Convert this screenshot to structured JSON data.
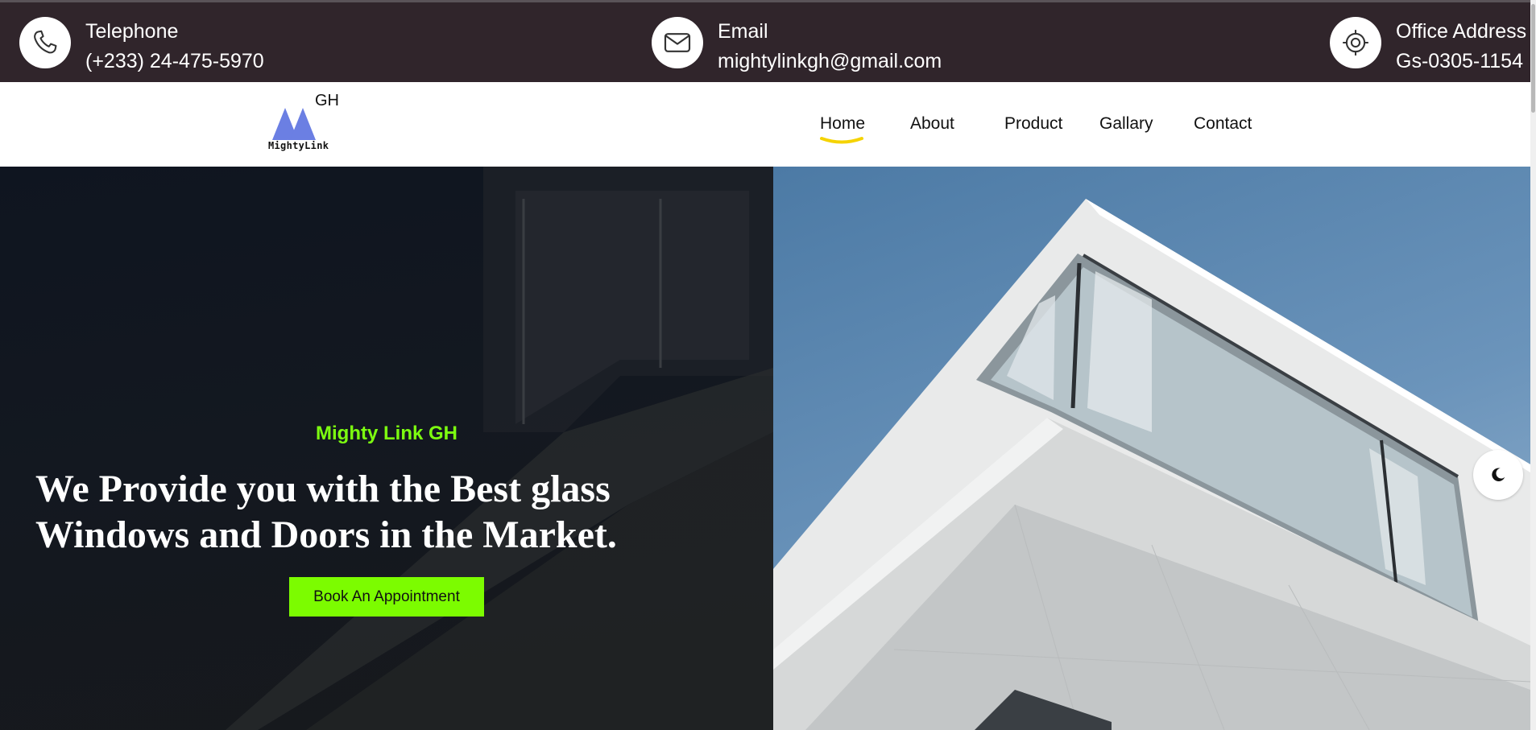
{
  "contact_bar": {
    "telephone": {
      "label": "Telephone",
      "value": "(+233) 24-475-5970",
      "icon": "phone-icon"
    },
    "email": {
      "label": "Email",
      "value": "mightylinkgh@gmail.com",
      "icon": "mail-icon"
    },
    "office": {
      "label": "Office Address",
      "value": "Gs-0305-1154",
      "icon": "location-icon"
    }
  },
  "logo": {
    "gh": "GH",
    "name": "MightyLink",
    "color": "#6b7fe3"
  },
  "nav": {
    "items": [
      "Home",
      "About",
      "Product",
      "Gallary",
      "Contact"
    ],
    "active": "Home",
    "underline_color": "#f5d300"
  },
  "hero": {
    "eyebrow": "Mighty Link GH",
    "headline": "We Provide you with the Best glass Windows and Doors in the Market.",
    "cta_label": "Book An Appointment",
    "accent_color": "#7cfc00"
  },
  "theme_toggle": {
    "icon": "moon-icon"
  }
}
